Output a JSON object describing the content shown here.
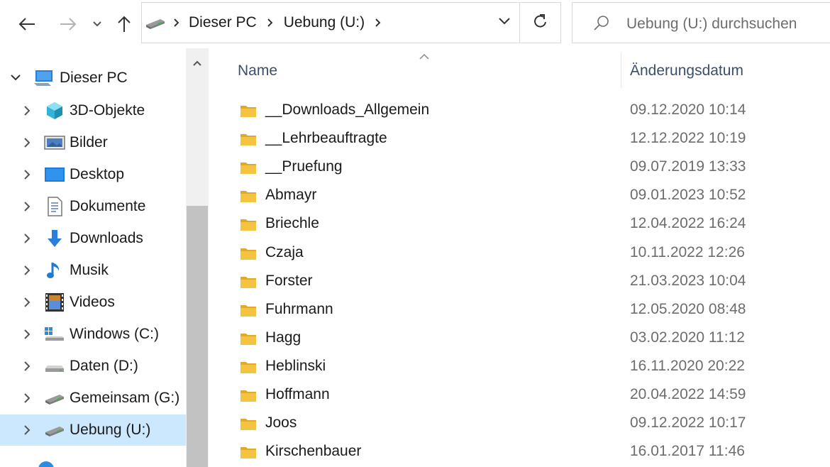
{
  "address": {
    "crumbs": [
      "Dieser PC",
      "Uebung (U:)"
    ],
    "drive_icon": "network-drive-icon"
  },
  "toolbar": {
    "back_icon": "arrow-left-icon",
    "forward_icon": "arrow-right-icon",
    "recent_icon": "chevron-down-icon",
    "up_icon": "arrow-up-icon",
    "refresh_icon": "refresh-icon"
  },
  "search": {
    "placeholder": "Uebung (U:) durchsuchen",
    "icon": "search-icon"
  },
  "nav": {
    "root": {
      "label": "Dieser PC",
      "icon": "this-pc-icon",
      "expanded": true
    },
    "items": [
      {
        "label": "3D-Objekte",
        "icon": "cube-icon"
      },
      {
        "label": "Bilder",
        "icon": "pictures-icon"
      },
      {
        "label": "Desktop",
        "icon": "desktop-icon"
      },
      {
        "label": "Dokumente",
        "icon": "documents-icon"
      },
      {
        "label": "Downloads",
        "icon": "download-arrow-icon"
      },
      {
        "label": "Musik",
        "icon": "music-note-icon"
      },
      {
        "label": "Videos",
        "icon": "film-icon"
      },
      {
        "label": "Windows (C:)",
        "icon": "windows-drive-icon"
      },
      {
        "label": "Daten (D:)",
        "icon": "drive-icon"
      },
      {
        "label": "Gemeinsam (G:)",
        "icon": "network-drive-icon"
      },
      {
        "label": "Uebung (U:)",
        "icon": "network-drive-icon",
        "selected": true
      }
    ]
  },
  "list": {
    "columns": {
      "name": "Name",
      "modified": "Änderungsdatum"
    },
    "sort_icon": "sort-ascending-icon",
    "rows": [
      {
        "name": "__Downloads_Allgemein",
        "modified": "09.12.2020 10:14"
      },
      {
        "name": "__Lehrbeauftragte",
        "modified": "12.12.2022 10:19"
      },
      {
        "name": "__Pruefung",
        "modified": "09.07.2019 13:33"
      },
      {
        "name": "Abmayr",
        "modified": "09.01.2023 10:52"
      },
      {
        "name": "Briechle",
        "modified": "12.04.2022 16:24"
      },
      {
        "name": "Czaja",
        "modified": "10.11.2022 12:26"
      },
      {
        "name": "Forster",
        "modified": "21.03.2023 10:04"
      },
      {
        "name": "Fuhrmann",
        "modified": "12.05.2020 08:48"
      },
      {
        "name": "Hagg",
        "modified": "03.02.2020 11:12"
      },
      {
        "name": "Heblinski",
        "modified": "16.11.2020 20:22"
      },
      {
        "name": "Hoffmann",
        "modified": "20.04.2022 14:59"
      },
      {
        "name": "Joos",
        "modified": "09.12.2022 10:17"
      },
      {
        "name": "Kirschenbauer",
        "modified": "16.01.2017 11:46"
      }
    ]
  },
  "colors": {
    "selected_bg": "#cce8ff",
    "folder": "#f5c342",
    "header_text": "#3a4f6c",
    "date_text": "#6d6d6d"
  }
}
